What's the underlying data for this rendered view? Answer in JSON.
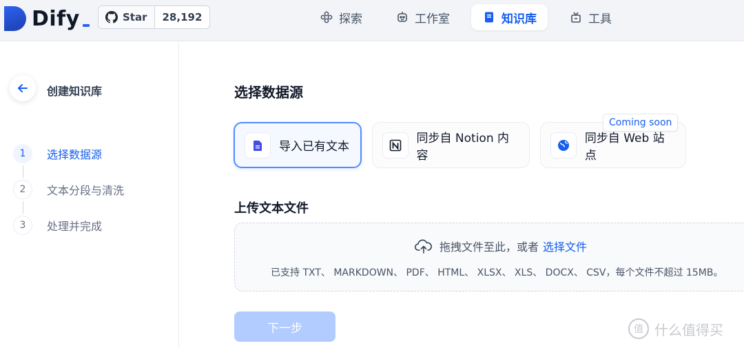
{
  "app": {
    "name": "Dify"
  },
  "github": {
    "star_label": "Star",
    "star_count": "28,192"
  },
  "nav": [
    {
      "label": "探索",
      "icon": "explore-icon"
    },
    {
      "label": "工作室",
      "icon": "robot-icon"
    },
    {
      "label": "知识库",
      "icon": "book-icon",
      "active": true
    },
    {
      "label": "工具",
      "icon": "tools-icon"
    }
  ],
  "sidebar": {
    "title": "创建知识库",
    "steps": [
      {
        "num": "1",
        "label": "选择数据源",
        "active": true
      },
      {
        "num": "2",
        "label": "文本分段与清洗",
        "active": false
      },
      {
        "num": "3",
        "label": "处理并完成",
        "active": false
      }
    ]
  },
  "main": {
    "title": "选择数据源",
    "sources": [
      {
        "label": "导入已有文本",
        "icon": "document-icon",
        "active": true
      },
      {
        "label": "同步自 Notion 内容",
        "icon": "notion-icon",
        "active": false
      },
      {
        "label": "同步自 Web 站点",
        "icon": "globe-icon",
        "active": false
      }
    ],
    "coming_soon": "Coming soon",
    "upload_title": "上传文本文件",
    "dropzone": {
      "hint": "拖拽文件至此，或者",
      "link": "选择文件",
      "supported": "已支持 TXT、 MARKDOWN、 PDF、 HTML、 XLSX、 XLS、 DOCX、 CSV，每个文件不超过 15MB。"
    },
    "next_button": "下一步"
  },
  "watermark": {
    "badge": "值",
    "text": "什么值得买"
  },
  "colors": {
    "accent": "#155eef",
    "disabled_button": "#b2ccff"
  }
}
